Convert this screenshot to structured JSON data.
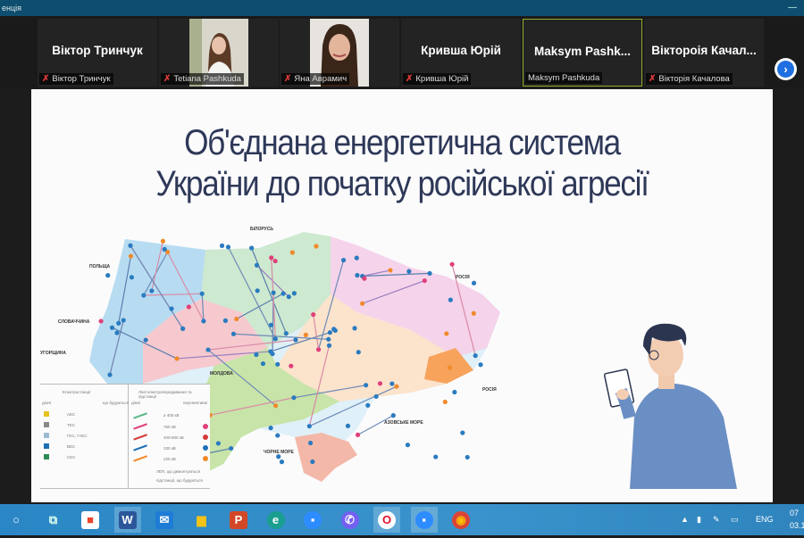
{
  "window": {
    "title": "енція",
    "minimize_label": "—"
  },
  "participants": [
    {
      "display": "Віктор Тринчук",
      "name": "Віктор Тринчук",
      "muted": true,
      "video": false
    },
    {
      "display": "",
      "name": "Tetiana Pashkuda",
      "muted": true,
      "video": true
    },
    {
      "display": "",
      "name": "Яна Аврамич",
      "muted": true,
      "video": true
    },
    {
      "display": "Кривша Юрій",
      "name": "Кривша Юрій",
      "muted": true,
      "video": false
    },
    {
      "display": "Maksym  Pashk...",
      "name": "Maksym Pashkuda",
      "muted": false,
      "video": false,
      "active_speaker": true
    },
    {
      "display": "Віктороія  Качал...",
      "name": "Вікторія Качалова",
      "muted": true,
      "video": false
    }
  ],
  "next_page_icon": "chevron-right-icon",
  "slide": {
    "title_line1": "Об'єднана енергетична система",
    "title_line2": "України до початку російської агресії",
    "map_labels": [
      "БІЛОРУСЬ",
      "ПОЛЬЩА",
      "СЛОВАЧЧИНА",
      "УГОРЩИНА",
      "РОСІЯ",
      "РОСІЯ",
      "МОЛДОВА",
      "ЧОРНЕ МОРЕ",
      "АЗОВСЬКЕ МОРЕ"
    ],
    "legend": {
      "left_header": "Електростанції",
      "left_sub": [
        "діючі",
        "що будуються"
      ],
      "plants": [
        "АЕС",
        "ТЕС",
        "ГЕС, ГАЕС",
        "ВЕС",
        "СЕС"
      ],
      "right_header": "Лінії електропередавання та підстанції",
      "right_sub": [
        "діючі",
        "перспективні"
      ],
      "voltages": [
        "≥ 400 кВ",
        "750 кВ",
        "400-500 кВ",
        "330 кВ",
        "220 кВ"
      ],
      "notes": [
        "ЛЕП, що демонтуються",
        "підстанції, що будуються"
      ]
    }
  },
  "colors": {
    "accent_active": "#8fae2a",
    "title": "#2e3858",
    "taskbar": "#2b86c5",
    "titlebar": "#0e4d6e"
  },
  "taskbar": {
    "apps": [
      "search",
      "task-view",
      "microsoft-store",
      "word",
      "mail",
      "file-explorer",
      "powerpoint",
      "edge",
      "zoom",
      "viber",
      "opera",
      "zoom",
      "chrome"
    ],
    "language": "ENG",
    "time": "07",
    "date": "03.11"
  }
}
